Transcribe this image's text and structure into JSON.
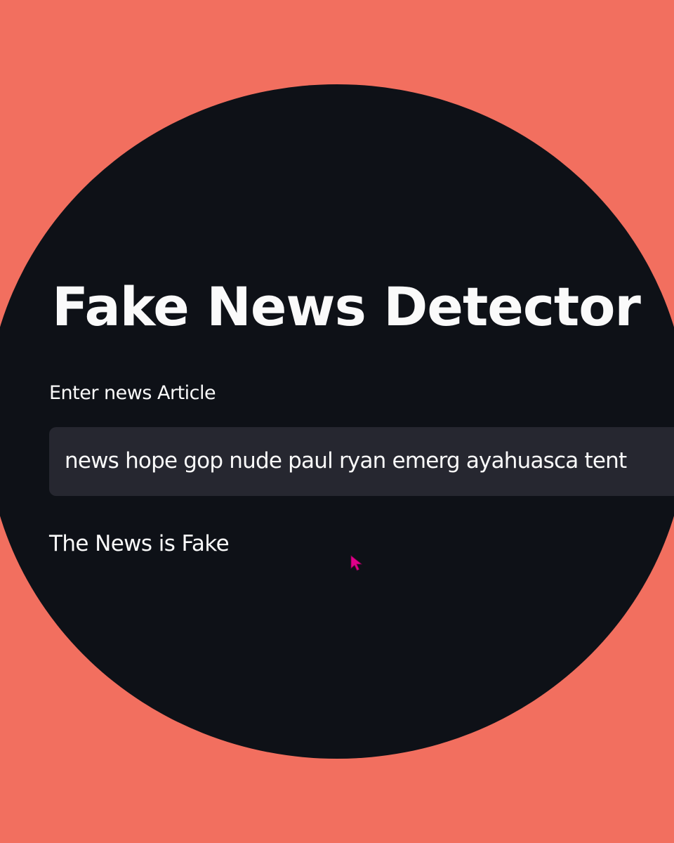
{
  "app": {
    "title": "Fake News Detector"
  },
  "input": {
    "label": "Enter news Article",
    "value": "news hope gop nude paul ryan emerg ayahuasca tent"
  },
  "result": {
    "text": "The News is Fake"
  },
  "colors": {
    "page_background": "#f26f5f",
    "app_background": "#0e1117",
    "input_background": "#262730",
    "text": "#fafafa",
    "cursor": "#e0008a"
  },
  "icons": {
    "cursor": "mouse-pointer-icon"
  }
}
